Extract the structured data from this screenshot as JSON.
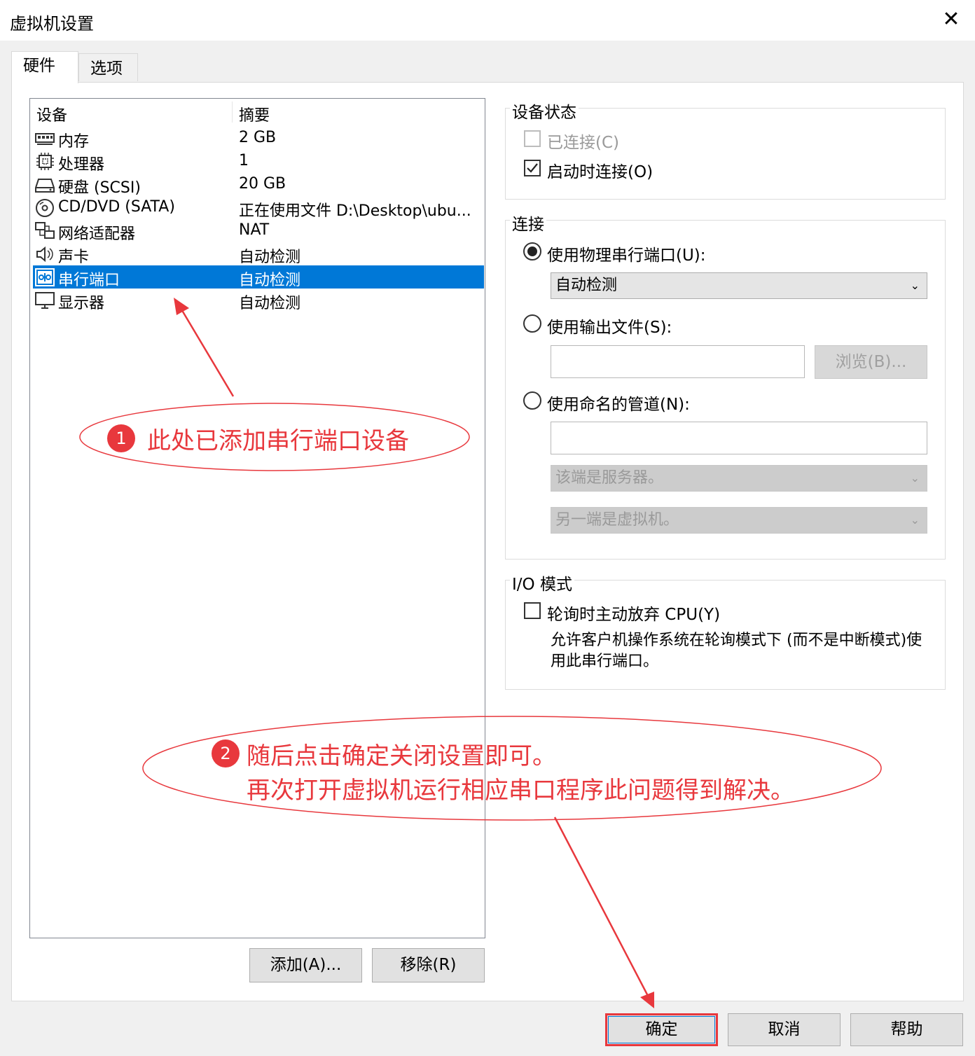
{
  "window": {
    "title": "虚拟机设置",
    "close_glyph": "✕"
  },
  "tabs": [
    {
      "label": "硬件",
      "active": true
    },
    {
      "label": "选项",
      "active": false
    }
  ],
  "device_list": {
    "headers": {
      "device": "设备",
      "summary": "摘要"
    },
    "rows": [
      {
        "icon": "memory-icon",
        "name": "内存",
        "summary": "2 GB"
      },
      {
        "icon": "processor-icon",
        "name": "处理器",
        "summary": "1"
      },
      {
        "icon": "hard-disk-icon",
        "name": "硬盘 (SCSI)",
        "summary": "20 GB"
      },
      {
        "icon": "cd-dvd-icon",
        "name": "CD/DVD (SATA)",
        "summary": "正在使用文件 D:\\Desktop\\ubu..."
      },
      {
        "icon": "network-adapter-icon",
        "name": "网络适配器",
        "summary": "NAT"
      },
      {
        "icon": "sound-card-icon",
        "name": "声卡",
        "summary": "自动检测"
      },
      {
        "icon": "serial-port-icon",
        "name": "串行端口",
        "summary": "自动检测",
        "selected": true
      },
      {
        "icon": "display-icon",
        "name": "显示器",
        "summary": "自动检测"
      }
    ],
    "add_button": "添加(A)...",
    "remove_button": "移除(R)"
  },
  "device_status": {
    "title": "设备状态",
    "connected": {
      "label": "已连接(C)",
      "checked": false,
      "disabled": true
    },
    "connect_on_start": {
      "label": "启动时连接(O)",
      "checked": true
    }
  },
  "connection": {
    "title": "连接",
    "physical_port": {
      "label": "使用物理串行端口(U):",
      "selected": true,
      "value": "自动检测"
    },
    "output_file": {
      "label": "使用输出文件(S):",
      "selected": false,
      "value": "",
      "browse_label": "浏览(B)..."
    },
    "named_pipe": {
      "label": "使用命名的管道(N):",
      "selected": false,
      "value": "",
      "end_select": "该端是服务器。",
      "other_end_select": "另一端是虚拟机。"
    }
  },
  "io_mode": {
    "title": "I/O 模式",
    "yield_cpu": {
      "label": "轮询时主动放弃 CPU(Y)",
      "checked": false
    },
    "description": "允许客户机操作系统在轮询模式下 (而不是中断模式)使用此串行端口。"
  },
  "footer": {
    "ok": "确定",
    "cancel": "取消",
    "help": "帮助"
  },
  "annotations": {
    "one": {
      "badge": "1",
      "text": "此处已添加串行端口设备"
    },
    "two": {
      "badge": "2",
      "line1": "随后点击确定关闭设置即可。",
      "line2": "再次打开虚拟机运行相应串口程序此问题得到解决。"
    }
  },
  "colors": {
    "selection": "#0078d7",
    "annotation": "#e8383d",
    "dialog_bg": "#f0f0f0"
  }
}
